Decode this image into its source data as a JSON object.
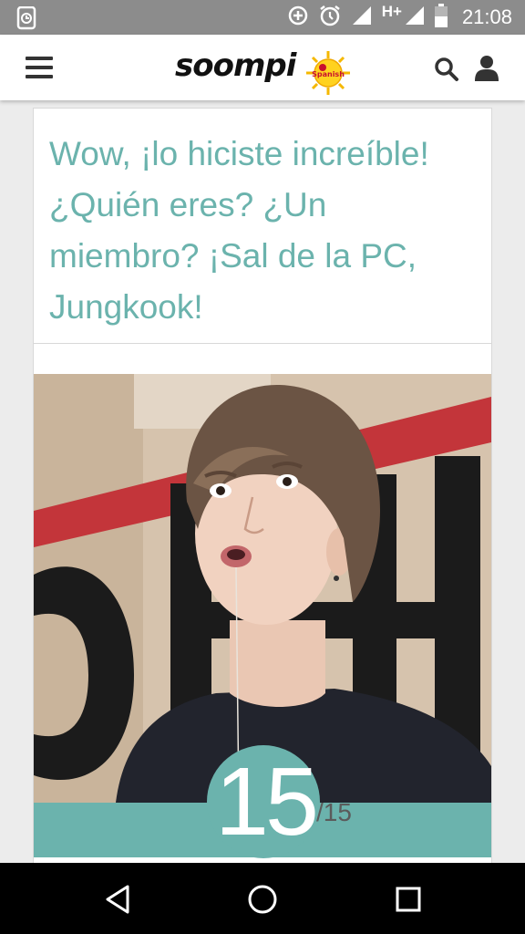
{
  "status_bar": {
    "time": "21:08",
    "network": "H+",
    "icons": [
      "screenshot-icon",
      "data-saver-icon",
      "alarm-icon",
      "signal-icon",
      "signal-icon",
      "battery-icon"
    ]
  },
  "header": {
    "logo_text": "soompi",
    "logo_badge": "Spanish",
    "icons": [
      "menu-icon",
      "search-icon",
      "user-icon"
    ]
  },
  "quiz": {
    "result_text": "Wow, ¡lo hiciste increíble! ¿Quién eres? ¿Un miembro? ¡Sal de la PC, Jungkook!",
    "counter_current": "15",
    "counter_total": "/15",
    "progress": 1.0
  },
  "colors": {
    "accent": "#6bb3ad",
    "status_bar": "#8c8c8c",
    "nav_bar": "#000000",
    "header_bg": "#ffffff"
  },
  "nav": {
    "icons": [
      "back-icon",
      "home-icon",
      "recents-icon"
    ]
  }
}
